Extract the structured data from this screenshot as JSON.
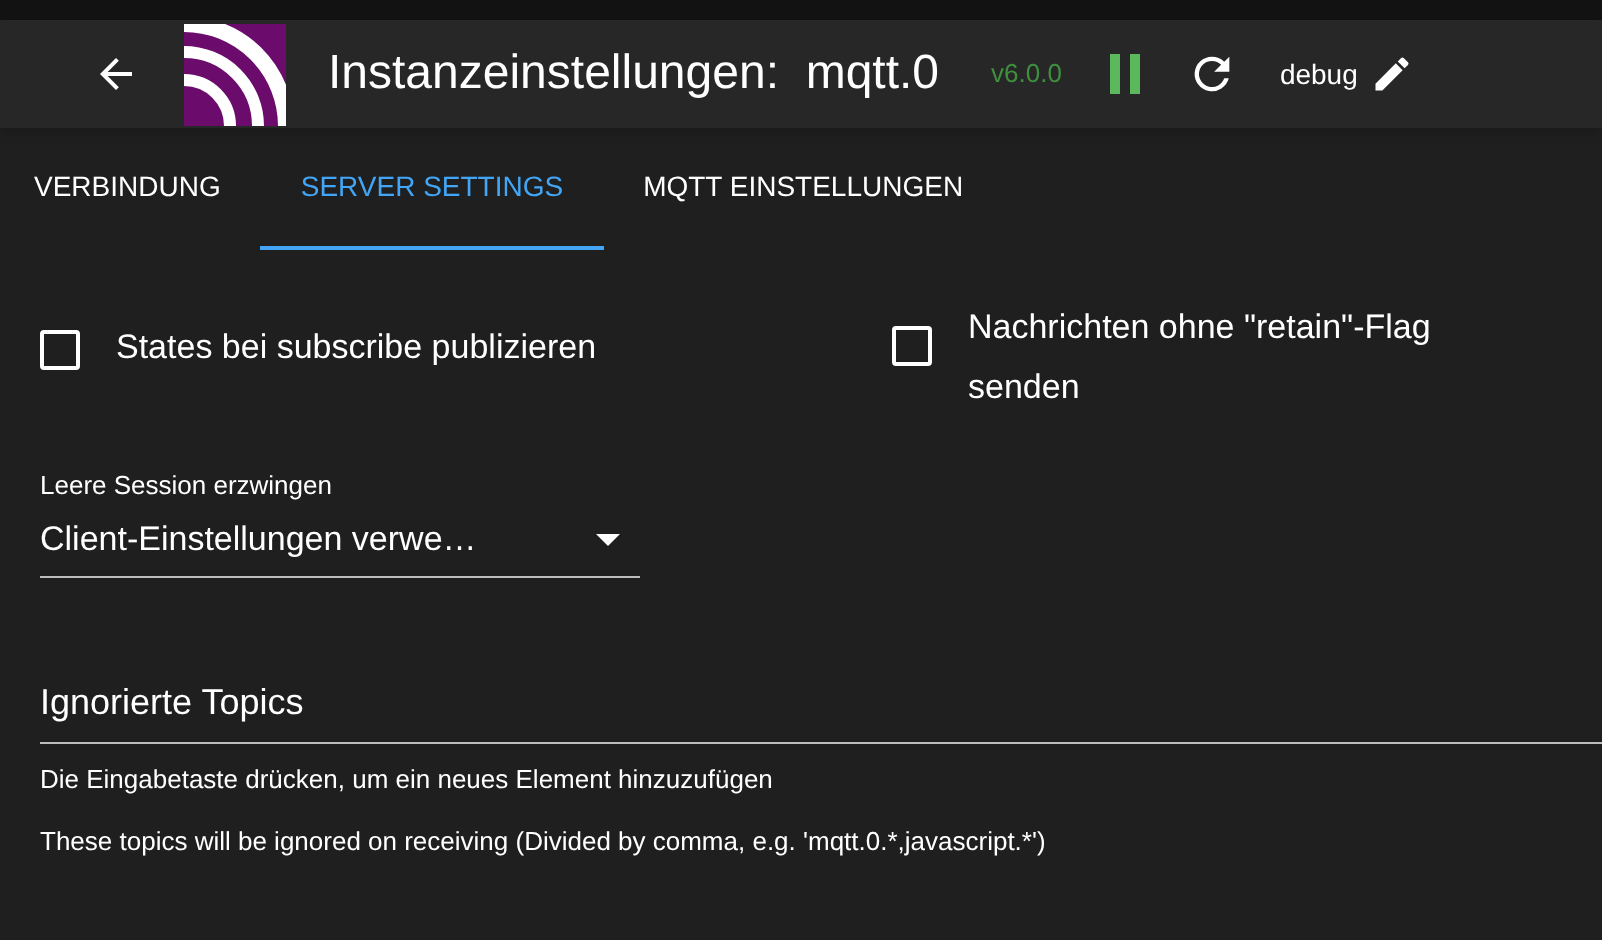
{
  "header": {
    "title": "Instanzeinstellungen:  mqtt.0",
    "version": "v6.0.0",
    "running": true,
    "log_level": "debug"
  },
  "tabs": [
    {
      "label": "VERBINDUNG",
      "selected": false
    },
    {
      "label": "SERVER SETTINGS",
      "selected": true
    },
    {
      "label": "MQTT EINSTELLUNGEN",
      "selected": false
    }
  ],
  "checkboxes": [
    {
      "label": "States bei subscribe publizieren",
      "checked": false
    },
    {
      "label": "Nachrichten ohne \"retain\"-Flag senden",
      "checked": false
    }
  ],
  "select": {
    "label": "Leere Session erzwingen",
    "value": "Client-Einstellungen verwe…"
  },
  "topics_field": {
    "placeholder": "Ignorierte Topics",
    "helper": "Die Eingabetaste drücken, um ein neues Element hinzuzufügen"
  },
  "note": "These topics will be ignored on receiving (Divided by comma, e.g. 'mqtt.0.*,javascript.*')"
}
